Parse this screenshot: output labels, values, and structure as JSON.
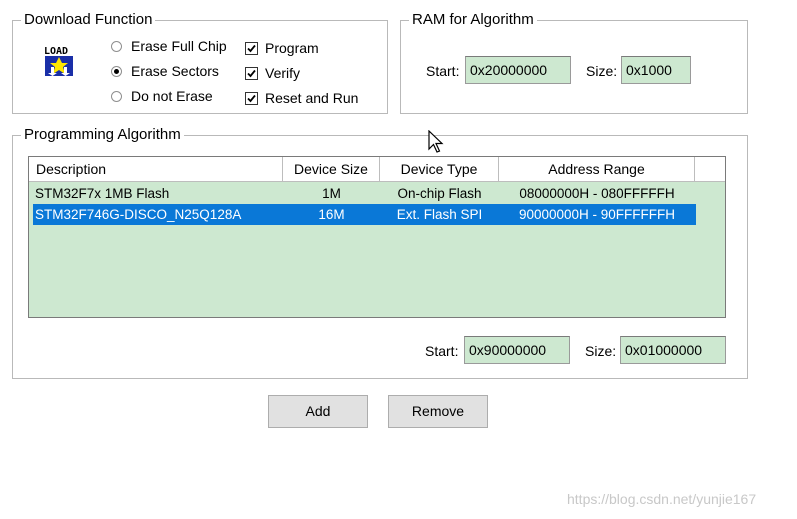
{
  "download": {
    "title": "Download Function",
    "icon": "load-icon",
    "erase_options": [
      {
        "label": "Erase Full Chip",
        "selected": false
      },
      {
        "label": "Erase Sectors",
        "selected": true
      },
      {
        "label": "Do not Erase",
        "selected": false
      }
    ],
    "checks": [
      {
        "label": "Program",
        "checked": true
      },
      {
        "label": "Verify",
        "checked": true
      },
      {
        "label": "Reset and Run",
        "checked": true
      }
    ]
  },
  "ram": {
    "title": "RAM for Algorithm",
    "start_label": "Start:",
    "start_value": "0x20000000",
    "size_label": "Size:",
    "size_value": "0x1000"
  },
  "algorithm": {
    "title": "Programming Algorithm",
    "columns": [
      "Description",
      "Device Size",
      "Device Type",
      "Address Range"
    ],
    "rows": [
      {
        "description": "STM32F7x 1MB Flash",
        "size": "1M",
        "type": "On-chip Flash",
        "range": "08000000H - 080FFFFFH",
        "selected": false
      },
      {
        "description": "STM32F746G-DISCO_N25Q128A",
        "size": "16M",
        "type": "Ext. Flash SPI",
        "range": "90000000H - 90FFFFFFH",
        "selected": true
      }
    ],
    "start_label": "Start:",
    "start_value": "0x90000000",
    "size_label": "Size:",
    "size_value": "0x01000000"
  },
  "buttons": {
    "add": "Add",
    "remove": "Remove"
  },
  "colors": {
    "field_bg": "#cde8d0",
    "selection": "#0a78d7",
    "button_bg": "#e1e1e1"
  },
  "watermark": "https://blog.csdn.net/yunjie167"
}
